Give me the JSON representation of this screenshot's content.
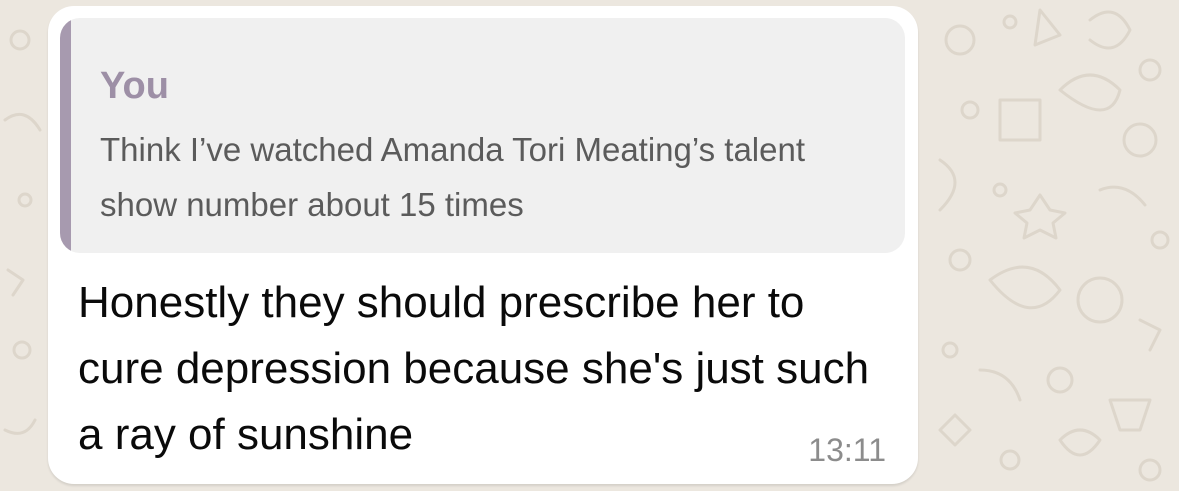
{
  "message": {
    "quoted": {
      "author": "You",
      "text": "Think I’ve watched Amanda Tori Meating’s talent show number about 15 times"
    },
    "text": "Honestly they should prescribe her to cure depression because she's just such a ray of sunshine",
    "time": "13:11"
  },
  "colors": {
    "background": "#ece7df",
    "bubble": "#ffffff",
    "quote_background": "#f0f0f0",
    "quote_accent": "#a79aaf",
    "quote_author": "#9d8fa6",
    "timestamp": "#8c8c8c"
  },
  "icons": {
    "wallpaper": "doodle-pattern-icon"
  }
}
